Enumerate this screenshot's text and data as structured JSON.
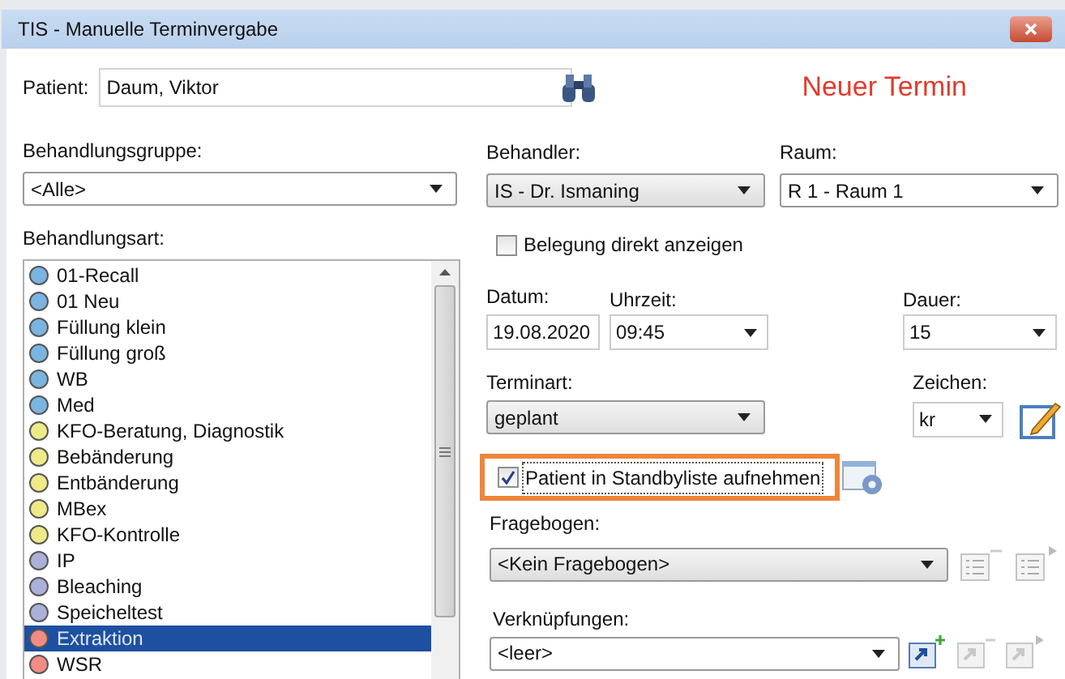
{
  "window": {
    "title": "TIS - Manuelle Terminvergabe"
  },
  "patient": {
    "label": "Patient:",
    "value": "Daum, Viktor"
  },
  "heading": "Neuer Termin",
  "behandlungsgruppe": {
    "label": "Behandlungsgruppe:",
    "value": "<Alle>"
  },
  "behandlungsart": {
    "label": "Behandlungsart:",
    "items": [
      {
        "label": "01-Recall",
        "color": "#7ab4e0",
        "selected": false
      },
      {
        "label": "01 Neu",
        "color": "#7ab4e0",
        "selected": false
      },
      {
        "label": "Füllung klein",
        "color": "#7ab4e0",
        "selected": false
      },
      {
        "label": "Füllung groß",
        "color": "#7ab4e0",
        "selected": false
      },
      {
        "label": "WB",
        "color": "#7ab4e0",
        "selected": false
      },
      {
        "label": "Med",
        "color": "#7ab4e0",
        "selected": false
      },
      {
        "label": "KFO-Beratung, Diagnostik",
        "color": "#eeea88",
        "selected": false
      },
      {
        "label": "Bebänderung",
        "color": "#eeea88",
        "selected": false
      },
      {
        "label": "Entbänderung",
        "color": "#eeea88",
        "selected": false
      },
      {
        "label": "MBex",
        "color": "#eeea88",
        "selected": false
      },
      {
        "label": "KFO-Kontrolle",
        "color": "#eeea88",
        "selected": false
      },
      {
        "label": "IP",
        "color": "#aab0d8",
        "selected": false
      },
      {
        "label": "Bleaching",
        "color": "#aab0d8",
        "selected": false
      },
      {
        "label": "Speicheltest",
        "color": "#aab0d8",
        "selected": false
      },
      {
        "label": "Extraktion",
        "color": "#f08c84",
        "selected": true
      },
      {
        "label": "WSR",
        "color": "#f08c84",
        "selected": false
      }
    ]
  },
  "behandler": {
    "label": "Behandler:",
    "value": "IS - Dr. Ismaning"
  },
  "raum": {
    "label": "Raum:",
    "value": "R 1 - Raum 1"
  },
  "belegung": {
    "label": "Belegung direkt anzeigen",
    "checked": false
  },
  "datum": {
    "label": "Datum:",
    "value": "19.08.2020"
  },
  "uhrzeit": {
    "label": "Uhrzeit:",
    "value": "09:45"
  },
  "dauer": {
    "label": "Dauer:",
    "value": "15"
  },
  "terminart": {
    "label": "Terminart:",
    "value": "geplant"
  },
  "zeichen": {
    "label": "Zeichen:",
    "value": "kr"
  },
  "standby": {
    "label": "Patient in Standbyliste aufnehmen",
    "checked": true
  },
  "fragebogen": {
    "label": "Fragebogen:",
    "value": "<Kein Fragebogen>"
  },
  "verknuepfungen": {
    "label": "Verknüpfungen:",
    "value": "<leer>"
  }
}
